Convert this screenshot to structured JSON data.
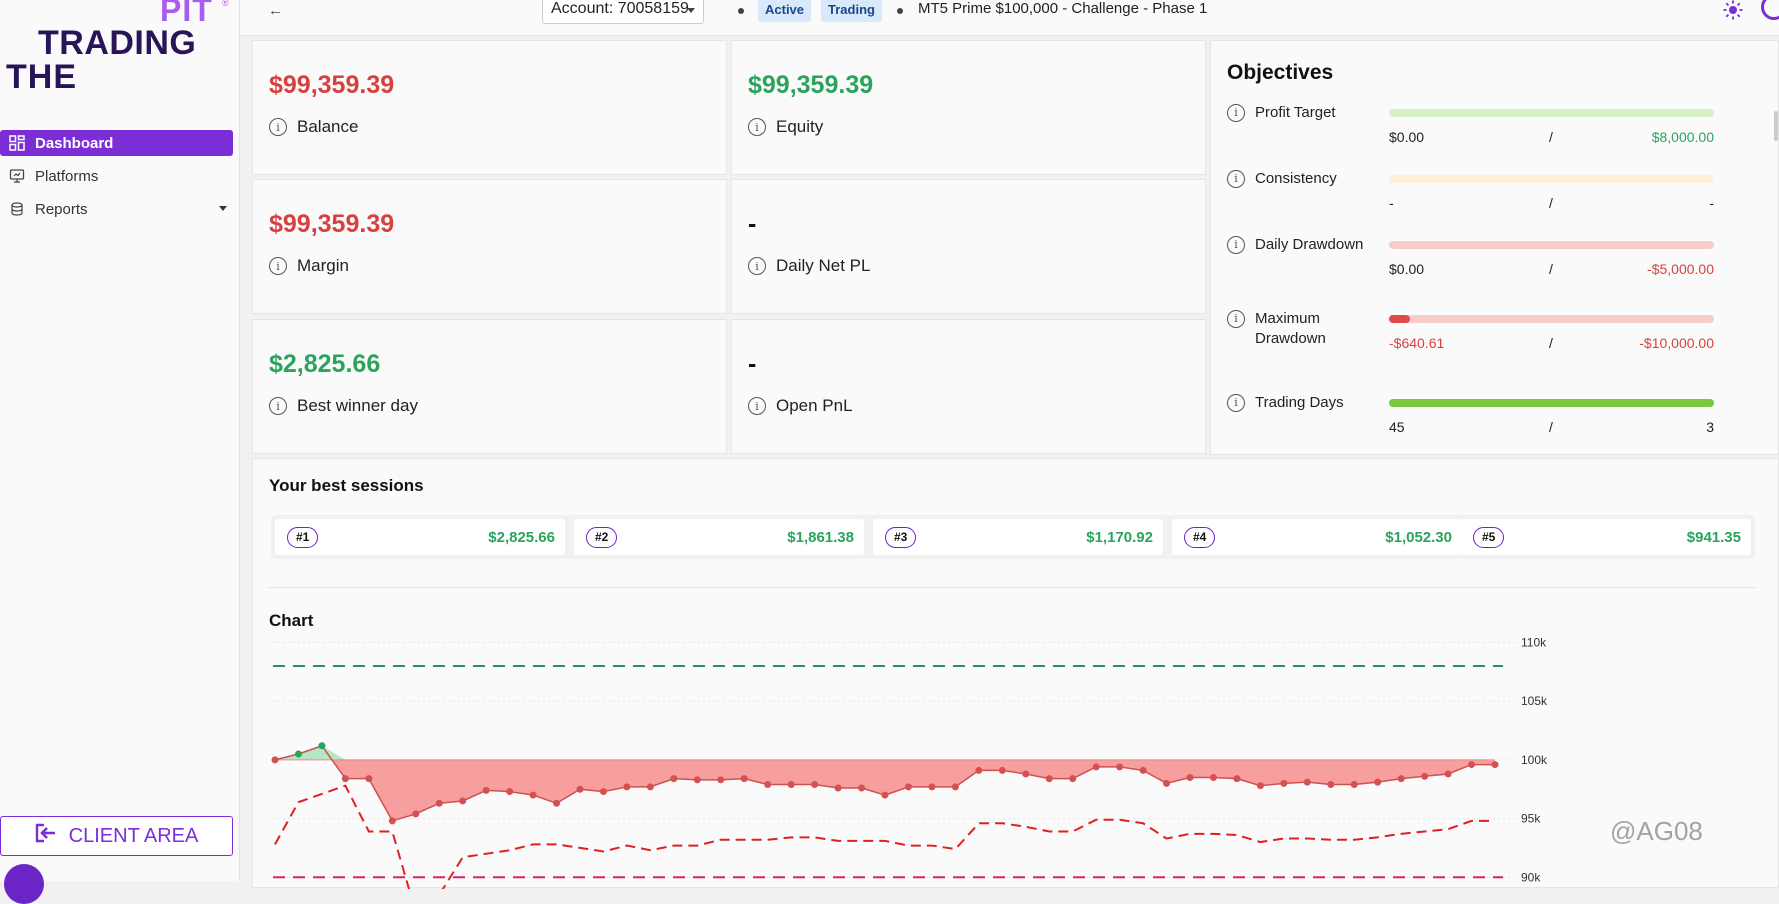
{
  "brand": {
    "pit": "PIT",
    "reg": "®",
    "trading": "TRADING",
    "the": "THE"
  },
  "sidebar": {
    "items": [
      {
        "label": "Dashboard",
        "icon": "grid-icon",
        "active": true
      },
      {
        "label": "Platforms",
        "icon": "platform-icon",
        "active": false
      },
      {
        "label": "Reports",
        "icon": "reports-icon",
        "active": false
      }
    ],
    "client_area": "CLIENT AREA"
  },
  "topbar": {
    "back_icon": "←",
    "account": "Account: 70058159",
    "status_active": "Active",
    "status_trading": "Trading",
    "account_name": "MT5 Prime $100,000 - Challenge - Phase 1"
  },
  "stats": [
    {
      "value": "$99,359.39",
      "label": "Balance",
      "color": "#d84040"
    },
    {
      "value": "$99,359.39",
      "label": "Equity",
      "color": "#2aa35c"
    },
    {
      "value": "$99,359.39",
      "label": "Margin",
      "color": "#d84040"
    },
    {
      "value": "-",
      "label": "Daily Net PL",
      "color": "#111111"
    },
    {
      "value": "$2,825.66",
      "label": "Best winner day",
      "color": "#2aa35c"
    },
    {
      "value": "-",
      "label": "Open PnL",
      "color": "#111111"
    }
  ],
  "objectives": {
    "title": "Objectives",
    "rows": [
      {
        "label": "Profit Target",
        "left": "$0.00",
        "right": "$8,000.00",
        "progress": 0,
        "track": "#d7f0c7",
        "fill": "#7cc94b",
        "left_color": "#222222",
        "right_color": "#2aa35c"
      },
      {
        "label": "Consistency",
        "left": "-",
        "right": "-",
        "progress": 0,
        "track": "#fdf2d8",
        "fill": "#f0c04a",
        "left_color": "#222222",
        "right_color": "#222222"
      },
      {
        "label": "Daily Drawdown",
        "left": "$0.00",
        "right": "-$5,000.00",
        "progress": 0,
        "track": "#f8cccc",
        "fill": "#e24a4a",
        "left_color": "#222222",
        "right_color": "#d84040"
      },
      {
        "label": "Maximum Drawdown",
        "left": "-$640.61",
        "right": "-$10,000.00",
        "progress": 0.064,
        "track": "#f8cccc",
        "fill": "#e24a4a",
        "left_color": "#d84040",
        "right_color": "#d84040"
      },
      {
        "label": "Trading Days",
        "left": "45",
        "right": "3",
        "progress": 1,
        "track": "#d7f0c7",
        "fill": "#7cc940",
        "left_color": "#222222",
        "right_color": "#222222"
      }
    ],
    "separator": "/"
  },
  "sessions": {
    "title": "Your best sessions",
    "items": [
      {
        "rank": "#1",
        "amount": "$2,825.66"
      },
      {
        "rank": "#2",
        "amount": "$1,861.38"
      },
      {
        "rank": "#3",
        "amount": "$1,170.92"
      },
      {
        "rank": "#4",
        "amount": "$1,052.30"
      },
      {
        "rank": "#5",
        "amount": "$941.35"
      }
    ]
  },
  "chart_title": "Chart",
  "chart_data": {
    "type": "line",
    "ylim": [
      89000,
      112000
    ],
    "yticks": [
      90000,
      95000,
      100000,
      105000,
      110000
    ],
    "ytick_labels": [
      "90k",
      "95k",
      "100k",
      "105k",
      "110k"
    ],
    "baseline": 100000,
    "target_line": 108000,
    "floor_line": 90000,
    "series": [
      {
        "values": [
          100000,
          100500,
          101200,
          98400,
          98400,
          94800,
          95400,
          96300,
          96500,
          97400,
          97300,
          97000,
          96300,
          97500,
          97300,
          97700,
          97700,
          98400,
          98300,
          98300,
          98400,
          97900,
          97900,
          97900,
          97600,
          97600,
          97000,
          97700,
          97700,
          97700,
          99100,
          99100,
          98800,
          98400,
          98400,
          99400,
          99400,
          99100,
          98000,
          98500,
          98500,
          98400,
          97800,
          98000,
          98100,
          97900,
          97900,
          98100,
          98400,
          98600,
          98800,
          99600,
          99600
        ]
      },
      {
        "values": [
          92800,
          96400,
          97100,
          97800,
          93900,
          93900,
          87000,
          88500,
          91700,
          92000,
          92300,
          92800,
          92800,
          92500,
          92200,
          92700,
          92300,
          92700,
          92700,
          93200,
          93200,
          93200,
          93400,
          93400,
          93100,
          93100,
          93100,
          92700,
          92700,
          92400,
          94600,
          94600,
          94300,
          93900,
          93900,
          94900,
          94900,
          94600,
          93300,
          93700,
          93700,
          93600,
          93000,
          93300,
          93300,
          93200,
          93200,
          93400,
          93700,
          93900,
          94100,
          94800,
          94800
        ]
      }
    ]
  },
  "watermark": "@AG08",
  "colors": {
    "accent": "#7b2ed6",
    "positive": "#2aa35c",
    "negative": "#d84040",
    "target": "#2c8a6e",
    "floor": "#d4236b",
    "area": "#f69393"
  }
}
